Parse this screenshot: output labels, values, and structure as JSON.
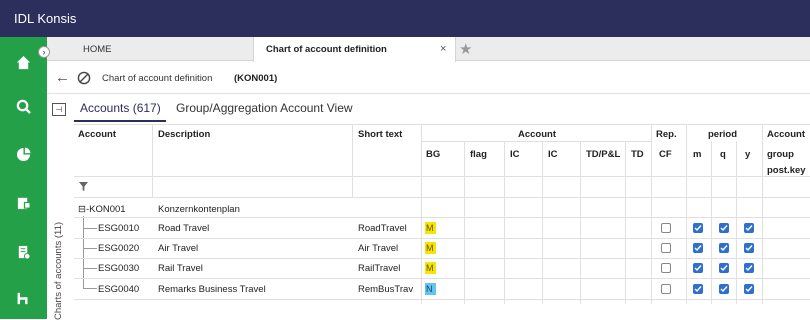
{
  "app": {
    "title": "IDL Konsis"
  },
  "sidebar": {
    "icons": [
      "home-icon",
      "search-icon",
      "chart-gear-icon",
      "report-icon",
      "document-gear-icon",
      "hierarchy-icon"
    ],
    "colors": {
      "background": "#24a148",
      "topbar": "#2c2e5c"
    }
  },
  "tabs": {
    "home": "HOME",
    "active": "Chart of account definition",
    "close": "×",
    "star": "★"
  },
  "breadcrumb": {
    "back": "←",
    "title": "Chart of account definition",
    "code": "(KON001)"
  },
  "side_panel": {
    "label": "Charts of accounts (11)",
    "toggle": "⊣"
  },
  "subtabs": {
    "accounts": "Accounts (617)",
    "group": "Group/Aggregation Account View"
  },
  "grid": {
    "headers": {
      "account": "Account",
      "description": "Description",
      "short_text": "Short text",
      "account_group": "Account",
      "rep": "Rep.",
      "period": "period",
      "account2": "Account"
    },
    "subheaders": {
      "bg": "BG",
      "flag": "flag",
      "ic1": "IC",
      "ic2": "IC",
      "tdpl": "TD/P&L",
      "td": "TD",
      "cf": "CF",
      "m": "m",
      "q": "q",
      "y": "y",
      "group": "group",
      "postkey": "post.key"
    },
    "filter_icon": "filter-icon",
    "root": {
      "account": "⊟-KON001",
      "description": "Konzernkontenplan"
    },
    "rows": [
      {
        "account": "ESG0010",
        "description": "Road Travel",
        "short_text": "RoadTravel",
        "bg": "M",
        "bg_color": "#f5e600",
        "cf": false,
        "m": true,
        "q": true,
        "y": true
      },
      {
        "account": "ESG0020",
        "description": "Air Travel",
        "short_text": "Air Travel",
        "bg": "M",
        "bg_color": "#f5e600",
        "cf": false,
        "m": true,
        "q": true,
        "y": true
      },
      {
        "account": "ESG0030",
        "description": "Rail Travel",
        "short_text": "RailTravel",
        "bg": "M",
        "bg_color": "#f5e600",
        "cf": false,
        "m": true,
        "q": true,
        "y": true
      },
      {
        "account": "ESG0040",
        "description": "Remarks Business Travel",
        "short_text": "RemBusTrav",
        "bg": "N",
        "bg_color": "#62c6ec",
        "cf": false,
        "m": true,
        "q": true,
        "y": true
      }
    ]
  }
}
